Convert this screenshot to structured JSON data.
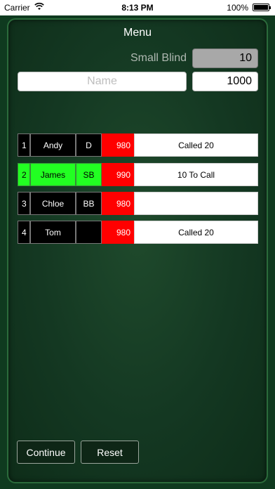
{
  "status_bar": {
    "carrier": "Carrier",
    "time": "8:13 PM",
    "battery": "100%"
  },
  "menu": {
    "title": "Menu"
  },
  "blind": {
    "label": "Small Blind",
    "value": "10"
  },
  "new_player": {
    "name_placeholder": "Name",
    "stack_value": "1000"
  },
  "players": [
    {
      "seat": "1",
      "name": "Andy",
      "position": "D",
      "stack": "980",
      "status": "Called 20",
      "highlighted": false
    },
    {
      "seat": "2",
      "name": "James",
      "position": "SB",
      "stack": "990",
      "status": "10 To Call",
      "highlighted": true
    },
    {
      "seat": "3",
      "name": "Chloe",
      "position": "BB",
      "stack": "980",
      "status": "",
      "highlighted": false
    },
    {
      "seat": "4",
      "name": "Tom",
      "position": "",
      "stack": "980",
      "status": "Called 20",
      "highlighted": false
    }
  ],
  "actions": {
    "continue_label": "Continue",
    "reset_label": "Reset"
  },
  "colors": {
    "table_green": "#143822",
    "active_row": "#22ff22",
    "stack_red": "#ff0000"
  },
  "icons": {
    "wifi": "wifi-icon",
    "battery": "battery-icon"
  }
}
